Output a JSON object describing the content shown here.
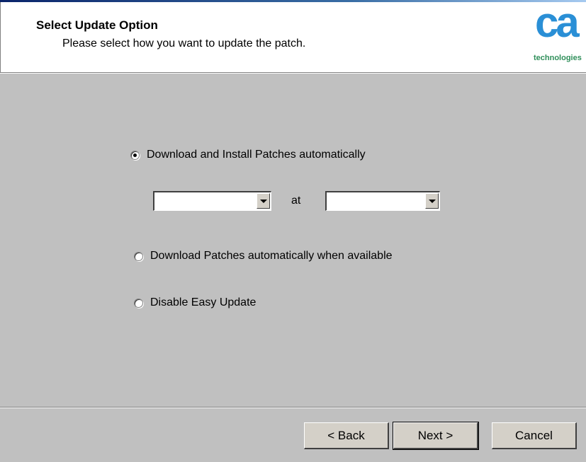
{
  "header": {
    "title": "Select Update Option",
    "subtitle": "Please select how you want to update the patch."
  },
  "logo": {
    "mark": "ca",
    "tagline": "technologies",
    "mark_color": "#2a8fd6",
    "tagline_color": "#2f8f5a"
  },
  "options": [
    {
      "label": "Download and Install Patches automatically",
      "checked": true
    },
    {
      "label": "Download Patches automatically when available",
      "checked": false
    },
    {
      "label": "Disable Easy Update",
      "checked": false
    }
  ],
  "schedule": {
    "day_value": "",
    "at_label": "at",
    "time_value": ""
  },
  "buttons": {
    "back": "< Back",
    "next": "Next >",
    "cancel": "Cancel"
  }
}
